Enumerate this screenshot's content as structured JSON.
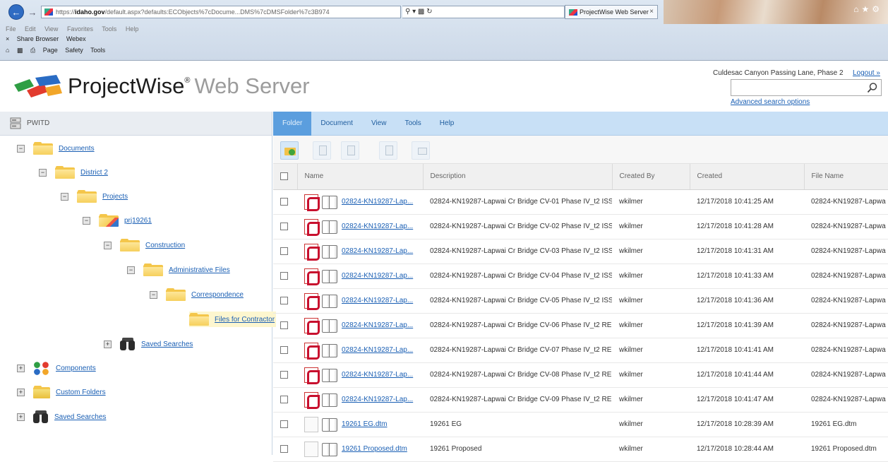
{
  "browser": {
    "url_prefix": "https://",
    "url_host": "idaho.gov",
    "url_rest": "/default.aspx?defaults:ECObjects%7cDocume...DMS%7cDMSFolder%7c3B974",
    "tab_title": "ProjectWise Web Server",
    "menu_items": [
      "File",
      "Edit",
      "View",
      "Favorites",
      "Tools",
      "Help"
    ],
    "favorites_items": [
      "Share Browser",
      "Webex"
    ],
    "command_items": [
      "Page",
      "Safety",
      "Tools"
    ]
  },
  "header": {
    "brand_main": "ProjectWise",
    "brand_registered": "®",
    "brand_sub": "Web Server",
    "project_name": "Culdesac Canyon Passing Lane, Phase 2",
    "logout": "Logout »",
    "search_placeholder": "",
    "advanced_search": "Advanced search options"
  },
  "tree": {
    "root_label": "PWITD",
    "nodes": [
      {
        "label": "Documents",
        "toggle": "−"
      },
      {
        "label": "District 2",
        "toggle": "−"
      },
      {
        "label": "Projects",
        "toggle": "−"
      },
      {
        "label": "prj19261",
        "toggle": "−"
      },
      {
        "label": "Construction",
        "toggle": "−"
      },
      {
        "label": "Administrative Files",
        "toggle": "−"
      },
      {
        "label": "Correspondence",
        "toggle": "−"
      },
      {
        "label": "Files for Contractor",
        "toggle": ""
      },
      {
        "label": "Saved Searches",
        "toggle": "+"
      },
      {
        "label": "Components",
        "toggle": "+"
      },
      {
        "label": "Custom Folders",
        "toggle": "+"
      },
      {
        "label": "Saved Searches",
        "toggle": "+"
      }
    ]
  },
  "menu": {
    "tabs": [
      "Folder",
      "Document",
      "View",
      "Tools",
      "Help"
    ]
  },
  "table": {
    "headers": [
      "Name",
      "Description",
      "Created By",
      "Created",
      "File Name"
    ],
    "rows": [
      {
        "name": "02824-KN19287-Lap...",
        "description": "02824-KN19287-Lapwai Cr Bridge CV-01 Phase IV_t2 ISS...",
        "created_by": "wkilmer",
        "created": "12/17/2018 10:41:25 AM",
        "file_name": "02824-KN19287-Lapwa"
      },
      {
        "name": "02824-KN19287-Lap...",
        "description": "02824-KN19287-Lapwai Cr Bridge CV-02 Phase IV_t2 ISS...",
        "created_by": "wkilmer",
        "created": "12/17/2018 10:41:28 AM",
        "file_name": "02824-KN19287-Lapwa"
      },
      {
        "name": "02824-KN19287-Lap...",
        "description": "02824-KN19287-Lapwai Cr Bridge CV-03 Phase IV_t2 ISS...",
        "created_by": "wkilmer",
        "created": "12/17/2018 10:41:31 AM",
        "file_name": "02824-KN19287-Lapwa"
      },
      {
        "name": "02824-KN19287-Lap...",
        "description": "02824-KN19287-Lapwai Cr Bridge CV-04 Phase IV_t2 ISS...",
        "created_by": "wkilmer",
        "created": "12/17/2018 10:41:33 AM",
        "file_name": "02824-KN19287-Lapwa"
      },
      {
        "name": "02824-KN19287-Lap...",
        "description": "02824-KN19287-Lapwai Cr Bridge CV-05 Phase IV_t2 ISS...",
        "created_by": "wkilmer",
        "created": "12/17/2018 10:41:36 AM",
        "file_name": "02824-KN19287-Lapwa"
      },
      {
        "name": "02824-KN19287-Lap...",
        "description": "02824-KN19287-Lapwai Cr Bridge CV-06 Phase IV_t2 RE...",
        "created_by": "wkilmer",
        "created": "12/17/2018 10:41:39 AM",
        "file_name": "02824-KN19287-Lapwa"
      },
      {
        "name": "02824-KN19287-Lap...",
        "description": "02824-KN19287-Lapwai Cr Bridge CV-07 Phase IV_t2 RE...",
        "created_by": "wkilmer",
        "created": "12/17/2018 10:41:41 AM",
        "file_name": "02824-KN19287-Lapwa"
      },
      {
        "name": "02824-KN19287-Lap...",
        "description": "02824-KN19287-Lapwai Cr Bridge CV-08 Phase IV_t2 RE...",
        "created_by": "wkilmer",
        "created": "12/17/2018 10:41:44 AM",
        "file_name": "02824-KN19287-Lapwa"
      },
      {
        "name": "02824-KN19287-Lap...",
        "description": "02824-KN19287-Lapwai Cr Bridge CV-09 Phase IV_t2 RE...",
        "created_by": "wkilmer",
        "created": "12/17/2018 10:41:47 AM",
        "file_name": "02824-KN19287-Lapwa"
      },
      {
        "name": "19261 EG.dtm",
        "description": "19261 EG",
        "created_by": "wkilmer",
        "created": "12/17/2018 10:28:39 AM",
        "file_name": "19261 EG.dtm"
      },
      {
        "name": "19261 Proposed.dtm",
        "description": "19261 Proposed",
        "created_by": "wkilmer",
        "created": "12/17/2018 10:28:44 AM",
        "file_name": "19261 Proposed.dtm"
      }
    ]
  }
}
